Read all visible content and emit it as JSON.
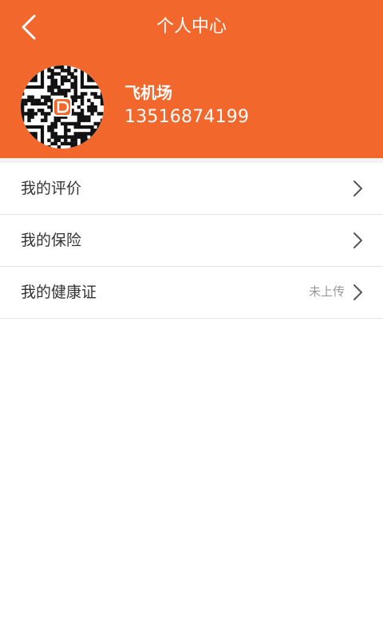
{
  "header": {
    "title": "个人中心",
    "back_icon": "chevron-left-icon",
    "background": "#f2672c",
    "user": {
      "name": "飞机场",
      "phone": "13516874199",
      "avatar": "qr-code-avatar"
    }
  },
  "menu": {
    "items": [
      {
        "label": "我的评价",
        "status": "",
        "icon": "chevron-right-icon"
      },
      {
        "label": "我的保险",
        "status": "",
        "icon": "chevron-right-icon"
      },
      {
        "label": "我的健康证",
        "status": "未上传",
        "icon": "chevron-right-icon"
      }
    ]
  },
  "colors": {
    "accent": "#f2672c",
    "divider": "#e3e3e3",
    "muted_text": "#999999"
  }
}
